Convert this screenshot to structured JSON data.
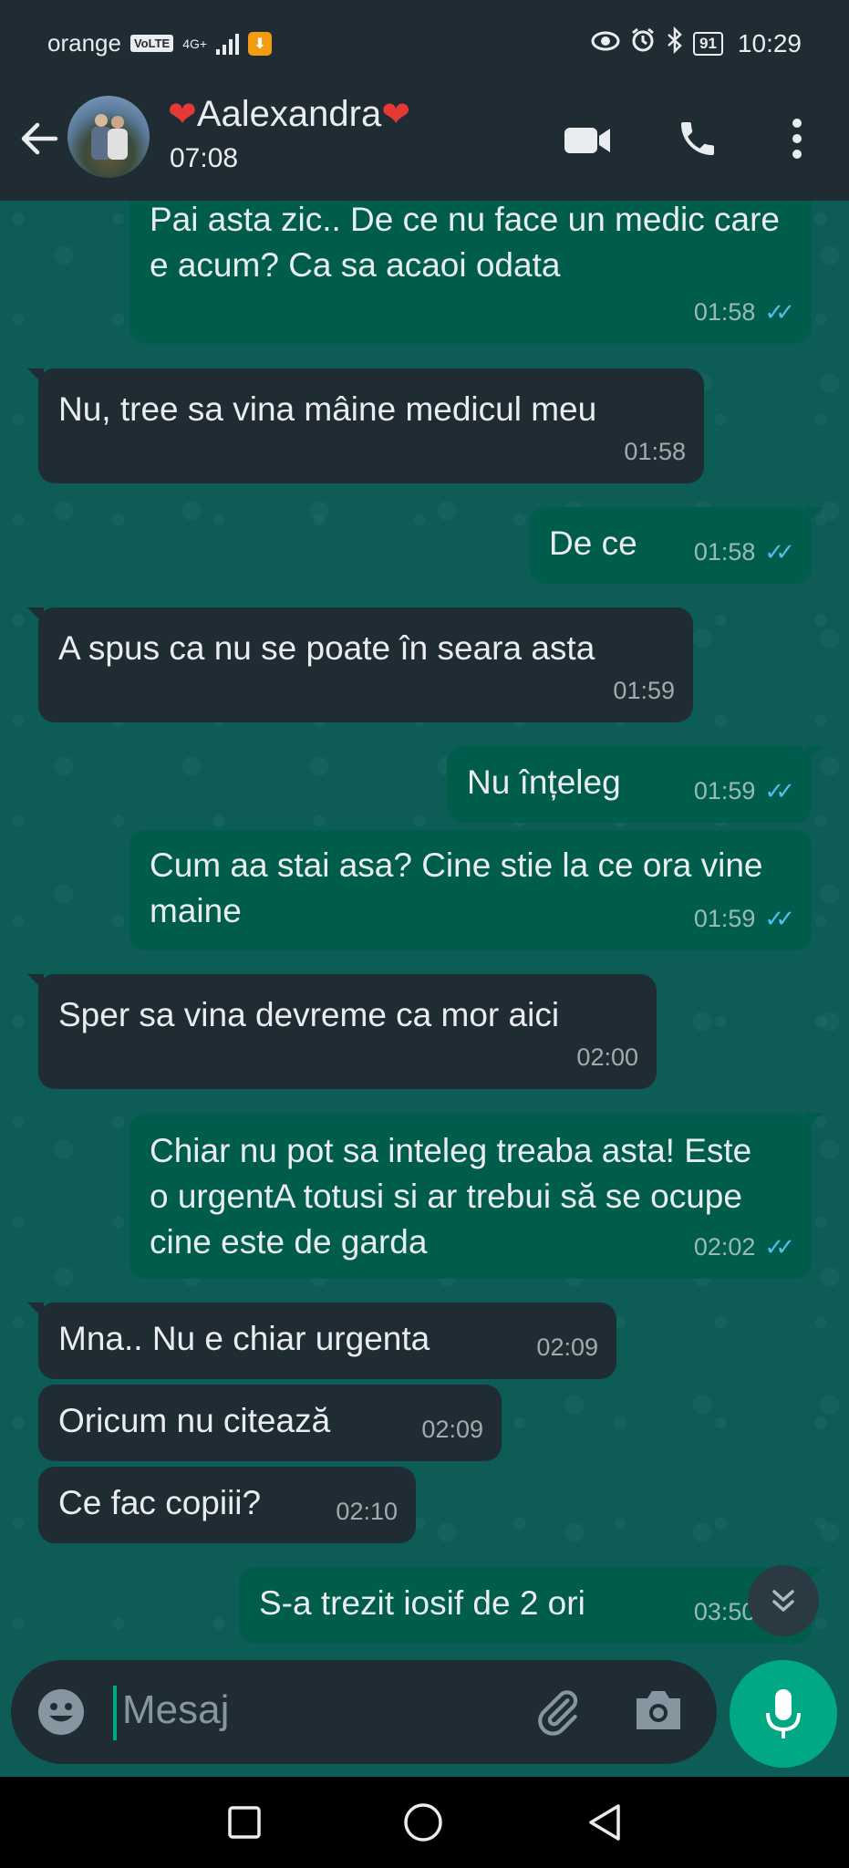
{
  "status_bar": {
    "carrier": "orange",
    "volte": "VoLTE",
    "network": "4G+",
    "battery": "91",
    "time": "10:29"
  },
  "header": {
    "name_prefix": "❤",
    "name": "Aalexandra",
    "name_suffix": "❤",
    "subtitle": "07:08"
  },
  "messages": [
    {
      "dir": "out",
      "text": "Pai asta zic.. De ce nu face un medic care e acum? Ca sa acaoi odata",
      "time": "01:58",
      "read": true
    },
    {
      "dir": "in",
      "text": "Nu, tree sa vina mâine medicul meu",
      "time": "01:58"
    },
    {
      "dir": "out",
      "text": "De ce",
      "time": "01:58",
      "read": true
    },
    {
      "dir": "in",
      "text": "A spus ca nu se poate în seara asta",
      "time": "01:59"
    },
    {
      "dir": "out",
      "text": "Nu înțeleg",
      "time": "01:59",
      "read": true
    },
    {
      "dir": "out",
      "text": "Cum aa stai asa? Cine stie la ce ora vine maine",
      "time": "01:59",
      "read": true
    },
    {
      "dir": "in",
      "text": "Sper sa vina devreme ca mor aici",
      "time": "02:00"
    },
    {
      "dir": "out",
      "text": "Chiar nu pot sa inteleg treaba asta! Este o urgentA totusi si ar trebui să se ocupe cine este de garda",
      "time": "02:02",
      "read": true
    },
    {
      "dir": "in",
      "text": "Mna.. Nu e chiar urgenta",
      "time": "02:09"
    },
    {
      "dir": "in",
      "text": "Oricum nu citează",
      "time": "02:09"
    },
    {
      "dir": "in",
      "text": "Ce fac copiii?",
      "time": "02:10"
    },
    {
      "dir": "out",
      "text": "S-a trezit iosif de 2 ori",
      "time": "03:50",
      "read": true
    }
  ],
  "composer": {
    "placeholder": "Mesaj"
  },
  "colors": {
    "header_bg": "#1f2c33",
    "chat_bg": "#0d5c56",
    "bubble_out": "#005c4b",
    "bubble_in": "#202c33",
    "accent": "#00a884",
    "read_ticks": "#53bdeb"
  },
  "icons": {
    "back": "arrow-left-icon",
    "video": "video-call-icon",
    "call": "phone-icon",
    "menu": "more-vert-icon",
    "emoji": "emoji-icon",
    "attach": "paperclip-icon",
    "camera": "camera-icon",
    "mic": "mic-icon",
    "scroll": "chevron-double-down-icon"
  }
}
